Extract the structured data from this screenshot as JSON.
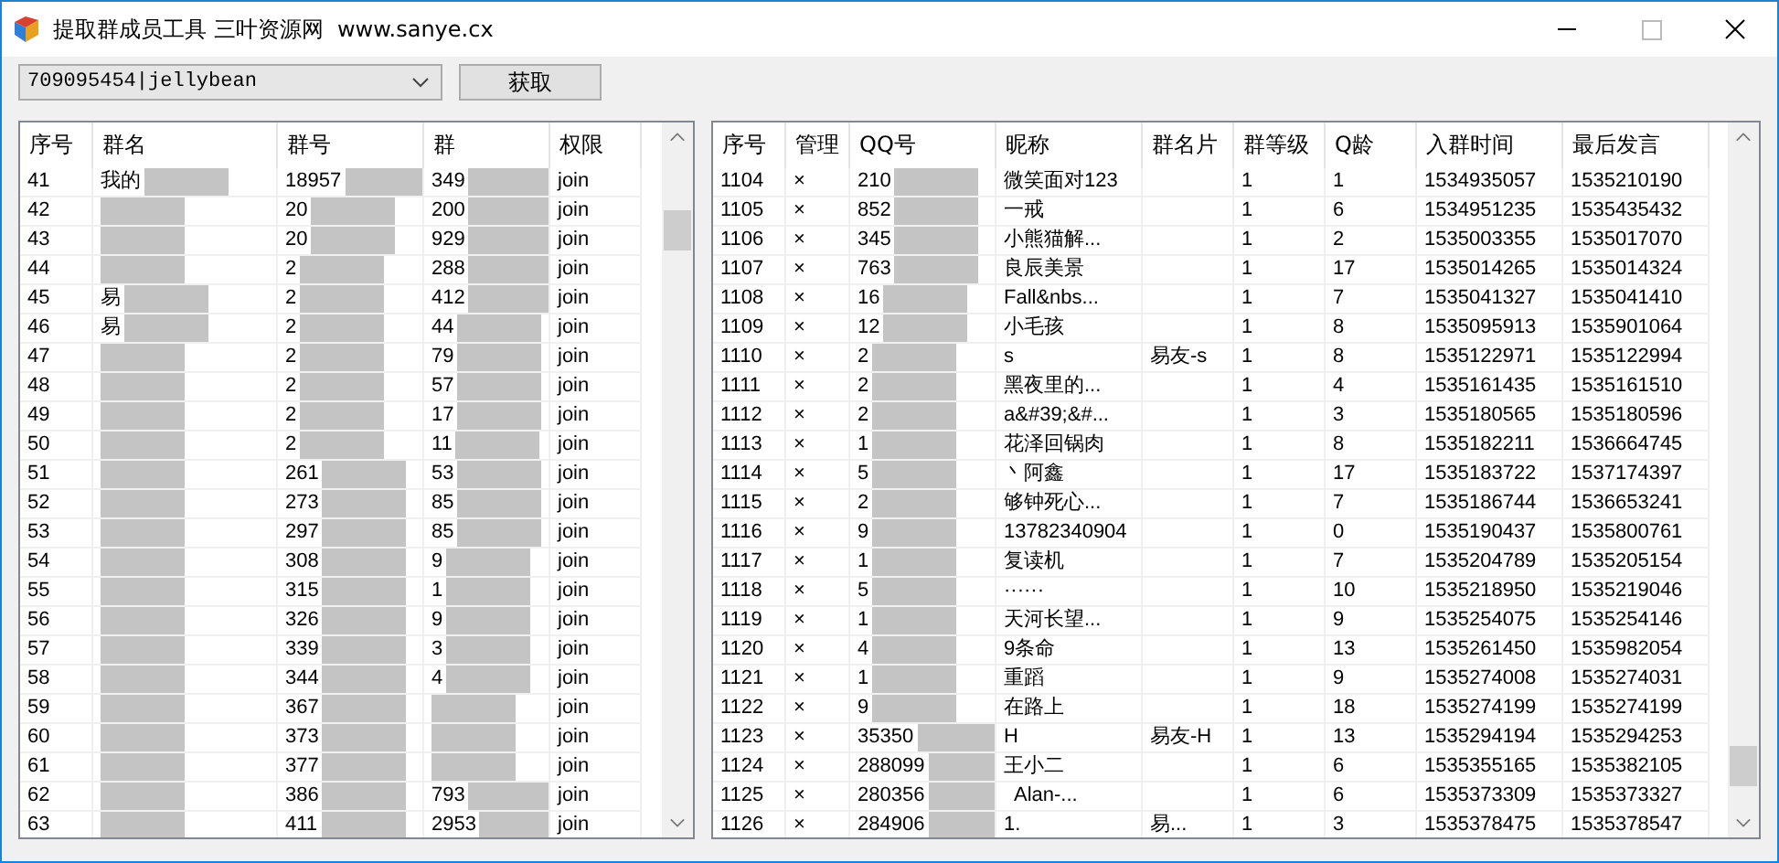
{
  "window": {
    "title": "提取群成员工具 三叶资源网  www.sanye.cx"
  },
  "account_select": {
    "value": "709095454|jellybean"
  },
  "fetch_button": {
    "label": "获取"
  },
  "groups_table": {
    "columns": [
      "序号",
      "群名",
      "群号",
      "群",
      "权限"
    ],
    "rows": [
      {
        "index": "41",
        "name": "我的",
        "number": "18957",
        "column_4": "349",
        "permission": "join"
      },
      {
        "index": "42",
        "number": "20",
        "column_4": "200",
        "permission": "join"
      },
      {
        "index": "43",
        "number": "20",
        "column_4": "929",
        "permission": "join"
      },
      {
        "index": "44",
        "number": "2",
        "column_4": "288",
        "permission": "join"
      },
      {
        "index": "45",
        "name": "易",
        "number": "2",
        "column_4": "412",
        "permission": "join"
      },
      {
        "index": "46",
        "name": "易",
        "number": "2",
        "column_4": "44",
        "permission": "join"
      },
      {
        "index": "47",
        "number": "2",
        "column_4": "79",
        "permission": "join"
      },
      {
        "index": "48",
        "number": "2",
        "column_4": "57",
        "permission": "join"
      },
      {
        "index": "49",
        "number": "2",
        "column_4": "17",
        "permission": "join"
      },
      {
        "index": "50",
        "number": "2",
        "column_4": "11",
        "permission": "join"
      },
      {
        "index": "51",
        "number": "261",
        "column_4": "53",
        "permission": "join"
      },
      {
        "index": "52",
        "number": "273",
        "column_4": "85",
        "permission": "join"
      },
      {
        "index": "53",
        "number": "297",
        "column_4": "85",
        "permission": "join"
      },
      {
        "index": "54",
        "number": "308",
        "column_4": "9",
        "permission": "join"
      },
      {
        "index": "55",
        "number": "315",
        "column_4": "1",
        "permission": "join"
      },
      {
        "index": "56",
        "number": "326",
        "column_4": "9",
        "permission": "join"
      },
      {
        "index": "57",
        "number": "339",
        "column_4": "3",
        "permission": "join"
      },
      {
        "index": "58",
        "number": "344",
        "column_4": "4",
        "permission": "join"
      },
      {
        "index": "59",
        "number": "367",
        "permission": "join"
      },
      {
        "index": "60",
        "number": "373",
        "permission": "join"
      },
      {
        "index": "61",
        "number": "377",
        "permission": "join"
      },
      {
        "index": "62",
        "number": "386",
        "column_4": "793",
        "permission": "join"
      },
      {
        "index": "63",
        "number": "411",
        "column_4": "2953",
        "permission": "join"
      }
    ]
  },
  "members_table": {
    "columns": [
      "序号",
      "管理",
      "QQ号",
      "昵称",
      "群名片",
      "群等级",
      "Q龄",
      "入群时间",
      "最后发言"
    ],
    "rows": [
      {
        "index": "1104",
        "admin": "×",
        "qq": "210",
        "nickname": "微笑面对123",
        "level": "1",
        "qq_age": "1",
        "join_time": "1534935057",
        "last_speak": "1535210190"
      },
      {
        "index": "1105",
        "admin": "×",
        "qq": "852",
        "nickname": "一戒",
        "level": "1",
        "qq_age": "6",
        "join_time": "1534951235",
        "last_speak": "1535435432"
      },
      {
        "index": "1106",
        "admin": "×",
        "qq": "345",
        "nickname": "小熊猫解...",
        "level": "1",
        "qq_age": "2",
        "join_time": "1535003355",
        "last_speak": "1535017070"
      },
      {
        "index": "1107",
        "admin": "×",
        "qq": "763",
        "nickname": "良辰美景",
        "level": "1",
        "qq_age": "17",
        "join_time": "1535014265",
        "last_speak": "1535014324"
      },
      {
        "index": "1108",
        "admin": "×",
        "qq": "16",
        "nickname": "Fall&nbs...",
        "level": "1",
        "qq_age": "7",
        "join_time": "1535041327",
        "last_speak": "1535041410"
      },
      {
        "index": "1109",
        "admin": "×",
        "qq": "12",
        "nickname": "小毛孩",
        "level": "1",
        "qq_age": "8",
        "join_time": "1535095913",
        "last_speak": "1535901064"
      },
      {
        "index": "1110",
        "admin": "×",
        "qq": "2",
        "nickname": "s",
        "card": "易友-s",
        "level": "1",
        "qq_age": "8",
        "join_time": "1535122971",
        "last_speak": "1535122994"
      },
      {
        "index": "1111",
        "admin": "×",
        "qq": "2",
        "nickname": "黑夜里的...",
        "level": "1",
        "qq_age": "4",
        "join_time": "1535161435",
        "last_speak": "1535161510"
      },
      {
        "index": "1112",
        "admin": "×",
        "qq": "2",
        "nickname": "a&#39;&#...",
        "level": "1",
        "qq_age": "3",
        "join_time": "1535180565",
        "last_speak": "1535180596"
      },
      {
        "index": "1113",
        "admin": "×",
        "qq": "1",
        "nickname": "花泽回锅肉",
        "level": "1",
        "qq_age": "8",
        "join_time": "1535182211",
        "last_speak": "1536664745"
      },
      {
        "index": "1114",
        "admin": "×",
        "qq": "5",
        "nickname": "丶阿鑫",
        "level": "1",
        "qq_age": "17",
        "join_time": "1535183722",
        "last_speak": "1537174397"
      },
      {
        "index": "1115",
        "admin": "×",
        "qq": "2",
        "nickname": "够钟死心...",
        "level": "1",
        "qq_age": "7",
        "join_time": "1535186744",
        "last_speak": "1536653241"
      },
      {
        "index": "1116",
        "admin": "×",
        "qq": "9",
        "nickname": "13782340904",
        "level": "1",
        "qq_age": "0",
        "join_time": "1535190437",
        "last_speak": "1535800761"
      },
      {
        "index": "1117",
        "admin": "×",
        "qq": "1",
        "nickname": "复读机",
        "level": "1",
        "qq_age": "7",
        "join_time": "1535204789",
        "last_speak": "1535205154"
      },
      {
        "index": "1118",
        "admin": "×",
        "qq": "5",
        "nickname": "······",
        "level": "1",
        "qq_age": "10",
        "join_time": "1535218950",
        "last_speak": "1535219046"
      },
      {
        "index": "1119",
        "admin": "×",
        "qq": "1",
        "nickname": "天河长望...",
        "level": "1",
        "qq_age": "9",
        "join_time": "1535254075",
        "last_speak": "1535254146"
      },
      {
        "index": "1120",
        "admin": "×",
        "qq": "4",
        "nickname": "9条命",
        "level": "1",
        "qq_age": "13",
        "join_time": "1535261450",
        "last_speak": "1535982054"
      },
      {
        "index": "1121",
        "admin": "×",
        "qq": "1",
        "nickname": "重蹈",
        "level": "1",
        "qq_age": "9",
        "join_time": "1535274008",
        "last_speak": "1535274031"
      },
      {
        "index": "1122",
        "admin": "×",
        "qq": "9",
        "nickname": "在路上",
        "level": "1",
        "qq_age": "18",
        "join_time": "1535274199",
        "last_speak": "1535274199"
      },
      {
        "index": "1123",
        "admin": "×",
        "qq": "35350",
        "nickname": "H",
        "card": "易友-H",
        "level": "1",
        "qq_age": "13",
        "join_time": "1535294194",
        "last_speak": "1535294253"
      },
      {
        "index": "1124",
        "admin": "×",
        "qq": "288099",
        "nickname": "王小二",
        "level": "1",
        "qq_age": "6",
        "join_time": "1535355165",
        "last_speak": "1535382105"
      },
      {
        "index": "1125",
        "admin": "×",
        "qq": "280356",
        "nickname": "  Alan-...",
        "level": "1",
        "qq_age": "6",
        "join_time": "1535373309",
        "last_speak": "1535373327"
      },
      {
        "index": "1126",
        "admin": "×",
        "qq": "284906",
        "nickname": "1.",
        "card": "易...",
        "level": "1",
        "qq_age": "3",
        "join_time": "1535378475",
        "last_speak": "1535378547"
      }
    ]
  }
}
